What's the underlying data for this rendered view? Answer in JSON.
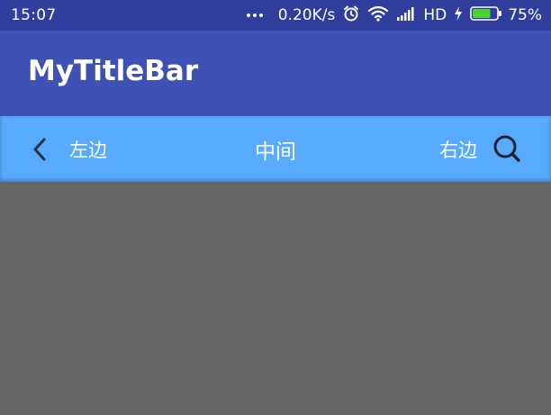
{
  "status_bar": {
    "time": "15:07",
    "network_speed": "0.20K/s",
    "network_type": "HD",
    "battery_percent": "75%",
    "battery_level": 0.75,
    "icons": [
      "more-dots-icon",
      "alarm-icon",
      "wifi-icon",
      "signal-icon",
      "charging-icon",
      "battery-icon"
    ]
  },
  "app_bar": {
    "title": "MyTitleBar"
  },
  "title_bar": {
    "left_label": "左边",
    "center_label": "中间",
    "right_label": "右边",
    "back_icon": "chevron-left-icon",
    "search_icon": "search-icon"
  },
  "colors": {
    "status_bar": "#2f3d9c",
    "app_bar": "#3f51b5",
    "title_bar": "#57aafd",
    "content_bg": "#666666",
    "battery_fill": "#4cd137"
  }
}
